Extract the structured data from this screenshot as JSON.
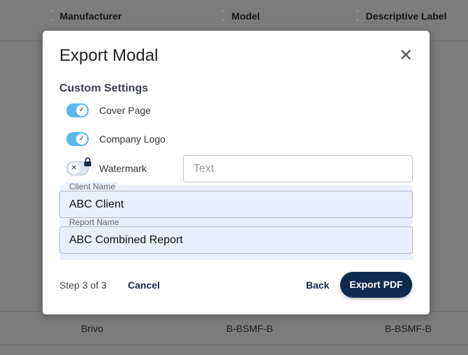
{
  "table": {
    "headers": [
      "Manufacturer",
      "Model",
      "Descriptive Label"
    ],
    "visible_row": [
      "Brivo",
      "B-BSMF-B",
      "B-BSMF-B"
    ]
  },
  "modal": {
    "title": "Export Modal",
    "section_title": "Custom Settings",
    "toggles": [
      {
        "label": "Cover Page",
        "on": true
      },
      {
        "label": "Company Logo",
        "on": true
      },
      {
        "label": "Watermark",
        "on": false,
        "locked": true
      }
    ],
    "watermark_placeholder": "Text",
    "client_name": {
      "label": "Client Name",
      "value": "ABC Client"
    },
    "report_name": {
      "label": "Report Name",
      "value": "ABC Combined Report"
    },
    "step": "Step 3 of 3",
    "cancel": "Cancel",
    "back": "Back",
    "export": "Export PDF",
    "accent": "#0f2a4f"
  }
}
